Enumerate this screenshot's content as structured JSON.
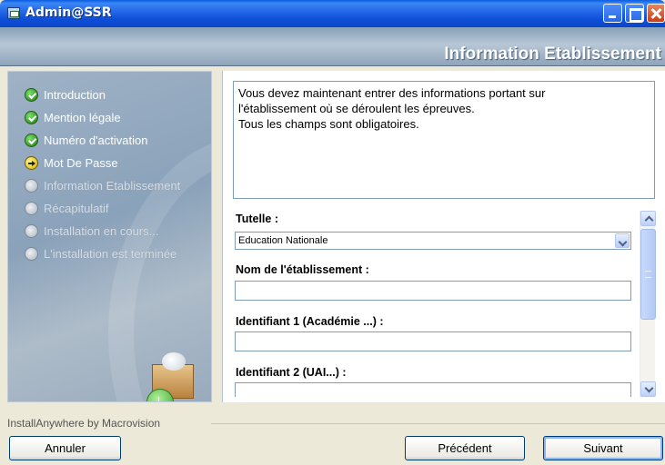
{
  "window": {
    "title": "Admin@SSR"
  },
  "header": {
    "heading": "Information Etablissement"
  },
  "steps": [
    {
      "label": "Introduction",
      "state": "done"
    },
    {
      "label": "Mention légale",
      "state": "done"
    },
    {
      "label": "Numéro d'activation",
      "state": "done"
    },
    {
      "label": "Mot De Passe",
      "state": "current"
    },
    {
      "label": "Information Etablissement",
      "state": "todo"
    },
    {
      "label": "Récapitulatif",
      "state": "todo"
    },
    {
      "label": "Installation en cours...",
      "state": "todo"
    },
    {
      "label": "L'installation est terminée",
      "state": "todo"
    }
  ],
  "info": {
    "line1": "Vous devez maintenant entrer des informations portant sur",
    "line2": "l'établissement où se déroulent les épreuves.",
    "line3": "Tous les champs sont obligatoires."
  },
  "form": {
    "tutelle_label": "Tutelle :",
    "tutelle_value": "Education Nationale",
    "nom_label": "Nom de l'établissement :",
    "nom_value": "",
    "id1_label": "Identifiant 1 (Académie ...) :",
    "id1_value": "",
    "id2_label": "Identifiant 2 (UAI...) :",
    "id2_value": ""
  },
  "footer": {
    "branding": "InstallAnywhere by Macrovision",
    "cancel_label": "Annuler",
    "previous_label": "Précédent",
    "next_label": "Suivant"
  },
  "colors": {
    "titlebar": "#0a5de0",
    "step_done": "#1d7a12",
    "step_current": "#d8b300",
    "panel": "#9fb2c6"
  }
}
